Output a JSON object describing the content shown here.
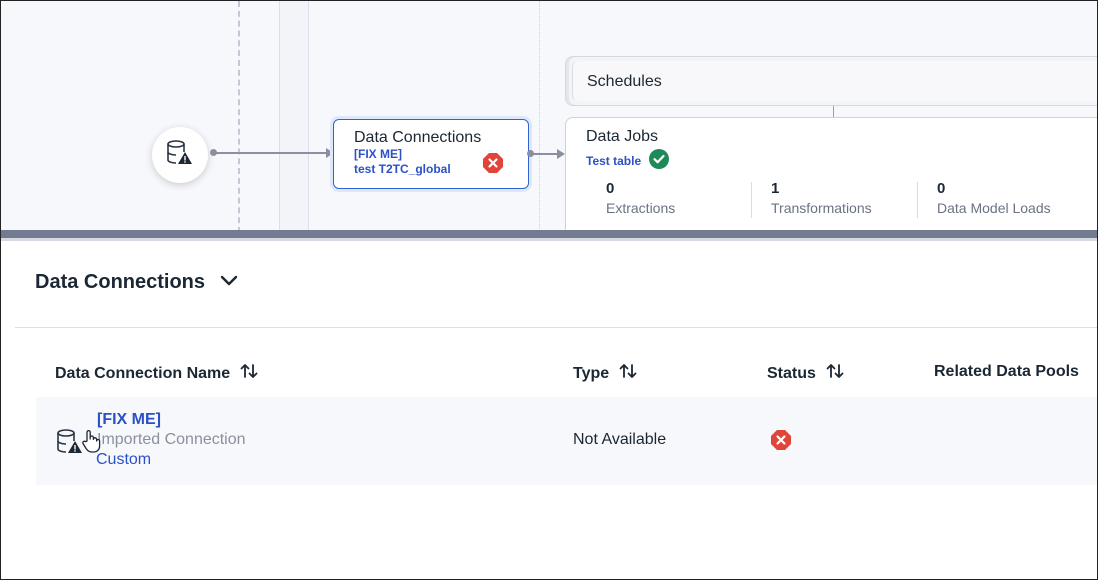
{
  "canvas": {
    "data_connection_node": {
      "title": "Data Connections",
      "line1": "[FIX ME]",
      "line2": "test T2TC_global",
      "status": "error"
    },
    "schedules_label": "Schedules",
    "data_jobs": {
      "title": "Data Jobs",
      "tag": "Test table",
      "tag_status": "success",
      "stats": [
        {
          "value": "0",
          "label": "Extractions"
        },
        {
          "value": "1",
          "label": "Transformations"
        },
        {
          "value": "0",
          "label": "Data Model Loads"
        }
      ]
    }
  },
  "panel": {
    "title": "Data Connections",
    "columns": {
      "name": "Data Connection Name",
      "type": "Type",
      "status": "Status",
      "pools": "Related Data Pools"
    },
    "rows": [
      {
        "name": "[FIX ME]",
        "description": "Imported Connection",
        "subtype": "Custom",
        "type": "Not Available",
        "status": "error"
      }
    ]
  },
  "colors": {
    "accent": "#2b50c8",
    "error": "#e0443a",
    "success": "#1e8a5a",
    "divider": "#727b90"
  }
}
